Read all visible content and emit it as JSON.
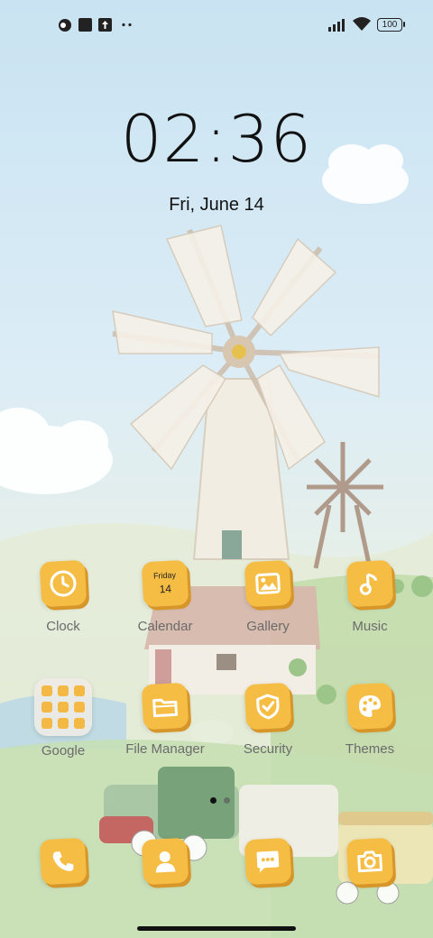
{
  "status_bar": {
    "notif_icons": [
      "app-icon",
      "square-icon",
      "upload-icon",
      "more-dots-icon"
    ],
    "battery": "100"
  },
  "lockscreen": {
    "time": "02:36",
    "date": "Fri, June 14"
  },
  "apps_row1": [
    {
      "label": "Clock",
      "icon": "clock-icon"
    },
    {
      "label": "Calendar",
      "icon": "calendar-icon",
      "day": "Friday",
      "num": "14"
    },
    {
      "label": "Gallery",
      "icon": "image-icon"
    },
    {
      "label": "Music",
      "icon": "music-note-icon"
    }
  ],
  "apps_row2": [
    {
      "label": "Google",
      "icon": "folder-icon"
    },
    {
      "label": "File Manager",
      "icon": "folder-file-icon"
    },
    {
      "label": "Security",
      "icon": "shield-check-icon"
    },
    {
      "label": "Themes",
      "icon": "palette-icon"
    }
  ],
  "dock": [
    {
      "icon": "phone-icon"
    },
    {
      "icon": "contacts-icon"
    },
    {
      "icon": "messages-icon"
    },
    {
      "icon": "camera-icon"
    }
  ],
  "colors": {
    "accent": "#f6bd45",
    "accent_dark": "#d6962a",
    "text": "#111111",
    "label": "#6b6b6b"
  }
}
